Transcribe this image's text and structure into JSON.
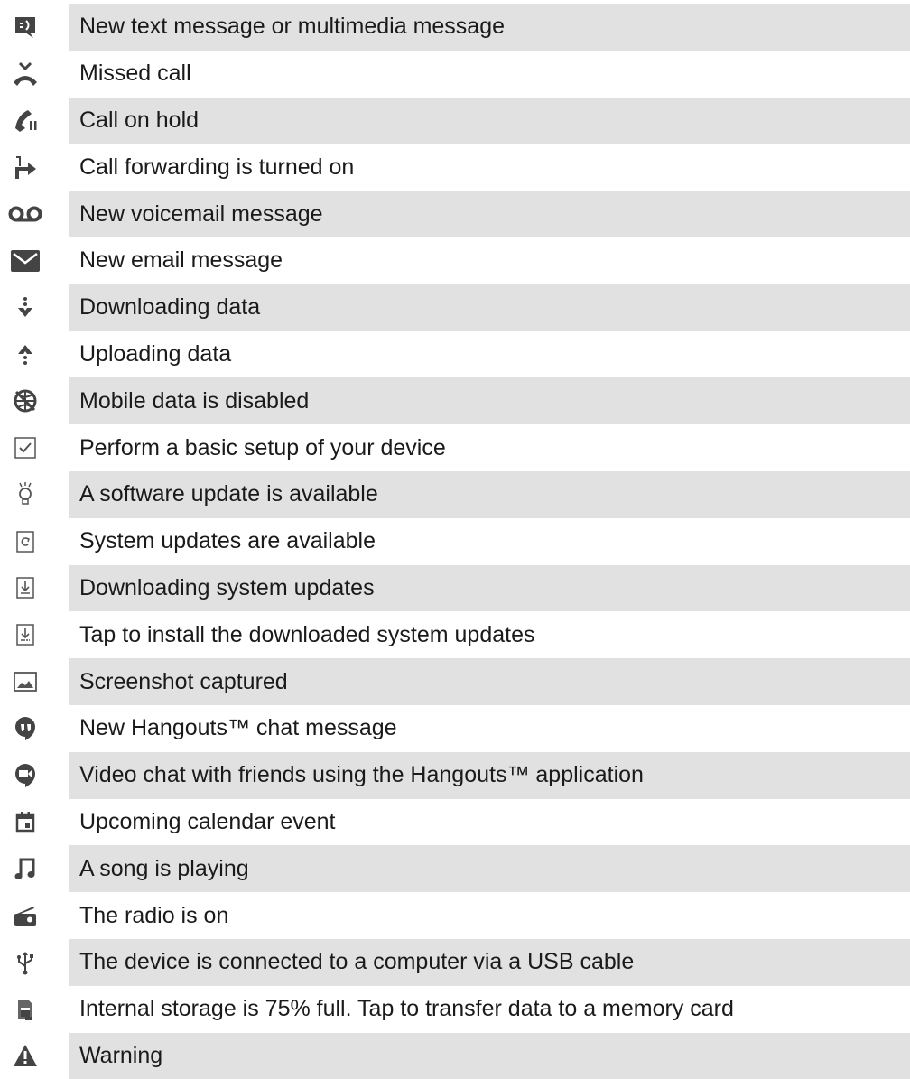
{
  "theme": {
    "row_shade": "#e1e1e1",
    "icon_color": "#444444",
    "text_color": "#1a1a1a"
  },
  "rows": [
    {
      "icon": "sms-message-icon",
      "label": "New text message or multimedia message"
    },
    {
      "icon": "missed-call-icon",
      "label": "Missed call"
    },
    {
      "icon": "call-on-hold-icon",
      "label": "Call on hold"
    },
    {
      "icon": "call-forwarding-icon",
      "label": "Call forwarding is turned on"
    },
    {
      "icon": "voicemail-icon",
      "label": "New voicemail message"
    },
    {
      "icon": "email-icon",
      "label": "New email message"
    },
    {
      "icon": "download-icon",
      "label": "Downloading data"
    },
    {
      "icon": "upload-icon",
      "label": "Uploading data"
    },
    {
      "icon": "mobile-data-disabled-icon",
      "label": "Mobile data is disabled"
    },
    {
      "icon": "setup-checkbox-icon",
      "label": "Perform a basic setup of your device"
    },
    {
      "icon": "lightbulb-icon",
      "label": "A software update is available"
    },
    {
      "icon": "system-update-icon",
      "label": "System updates are available"
    },
    {
      "icon": "downloading-system-update-icon",
      "label": "Downloading system updates"
    },
    {
      "icon": "install-update-icon",
      "label": "Tap to install the downloaded system updates"
    },
    {
      "icon": "screenshot-icon",
      "label": "Screenshot captured"
    },
    {
      "icon": "hangouts-chat-icon",
      "label": "New Hangouts™ chat message"
    },
    {
      "icon": "hangouts-video-icon",
      "label": "Video chat with friends using the Hangouts™ application"
    },
    {
      "icon": "calendar-icon",
      "label": "Upcoming calendar event"
    },
    {
      "icon": "music-note-icon",
      "label": "A song is playing"
    },
    {
      "icon": "radio-icon",
      "label": "The radio is on"
    },
    {
      "icon": "usb-icon",
      "label": "The device is connected to a computer via a USB cable"
    },
    {
      "icon": "storage-full-icon",
      "label": "Internal storage is 75% full. Tap to transfer data to a memory card"
    },
    {
      "icon": "warning-icon",
      "label": "Warning"
    }
  ]
}
